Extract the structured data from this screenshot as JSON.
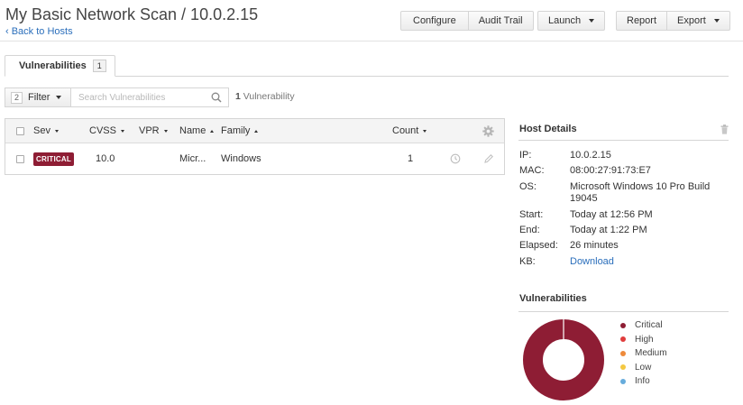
{
  "header": {
    "title": "My Basic Network Scan / 10.0.2.15",
    "back_link": "‹ Back to Hosts",
    "buttons": {
      "configure": "Configure",
      "audit_trail": "Audit Trail",
      "launch": "Launch",
      "report": "Report",
      "export": "Export"
    }
  },
  "tabs": [
    {
      "label": "Vulnerabilities",
      "count": "1"
    }
  ],
  "filter": {
    "count": "2",
    "label": "Filter",
    "search_placeholder": "Search Vulnerabilities",
    "result_count": "1",
    "result_label": "Vulnerability"
  },
  "table": {
    "columns": {
      "sev": "Sev",
      "cvss": "CVSS",
      "vpr": "VPR",
      "name": "Name",
      "family": "Family",
      "count": "Count"
    },
    "rows": [
      {
        "severity": "CRITICAL",
        "cvss": "10.0",
        "vpr": "",
        "name": "Micr...",
        "family": "Windows",
        "count": "1"
      }
    ]
  },
  "host_details": {
    "title": "Host Details",
    "fields": [
      {
        "key": "IP:",
        "value": "10.0.2.15"
      },
      {
        "key": "MAC:",
        "value": "08:00:27:91:73:E7"
      },
      {
        "key": "OS:",
        "value": "Microsoft Windows 10 Pro Build 19045"
      },
      {
        "key": "Start:",
        "value": "Today at 12:56 PM"
      },
      {
        "key": "End:",
        "value": "Today at 1:22 PM"
      },
      {
        "key": "Elapsed:",
        "value": "26 minutes"
      },
      {
        "key": "KB:",
        "value": "Download"
      }
    ]
  },
  "vulnerabilities_panel": {
    "title": "Vulnerabilities",
    "legend": [
      {
        "label": "Critical",
        "color": "#8e1d34"
      },
      {
        "label": "High",
        "color": "#e03c3c"
      },
      {
        "label": "Medium",
        "color": "#ee8a3a"
      },
      {
        "label": "Low",
        "color": "#f4c842"
      },
      {
        "label": "Info",
        "color": "#67acdc"
      }
    ],
    "donut": [
      {
        "label": "Critical",
        "value": 1
      }
    ]
  },
  "colors": {
    "critical": "#8e1d34",
    "link": "#2a6ebb"
  }
}
